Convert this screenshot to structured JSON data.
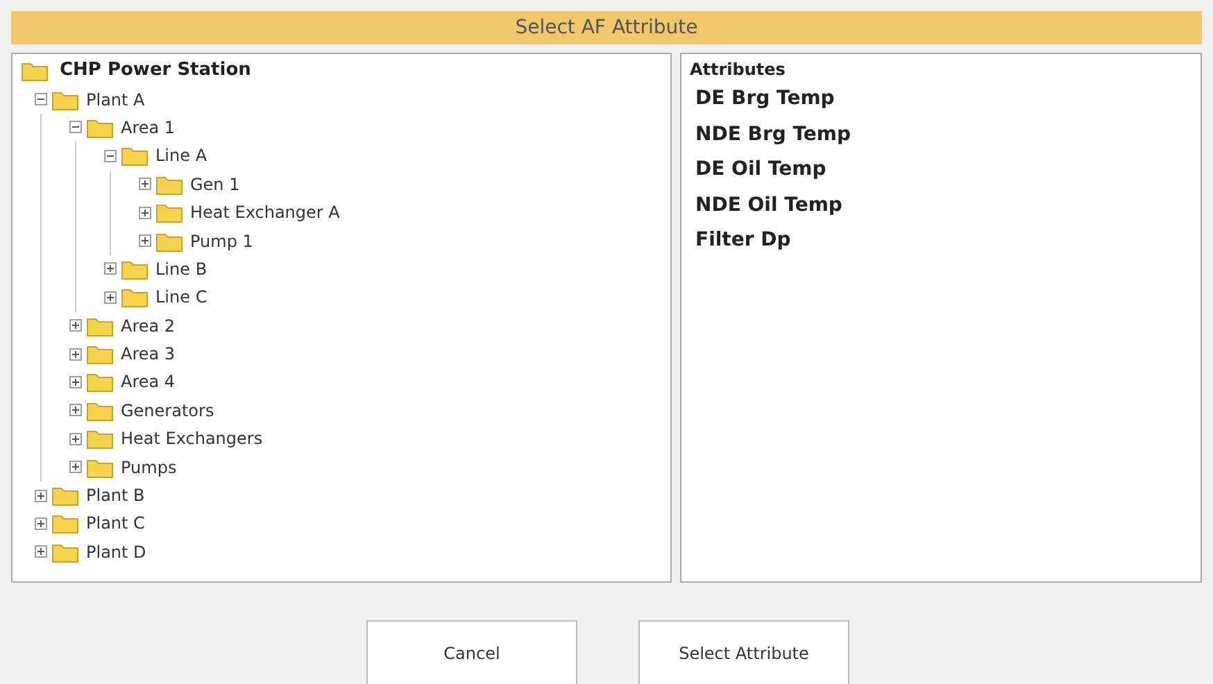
{
  "window": {
    "title": "Select AF Attribute"
  },
  "tree": {
    "label": "CHP Power Station",
    "children": [
      {
        "label": "Plant A",
        "expanded": true,
        "children": [
          {
            "label": "Area 1",
            "expanded": true,
            "children": [
              {
                "label": "Line A",
                "expanded": true,
                "children": [
                  {
                    "label": "Gen 1",
                    "expanded": false
                  },
                  {
                    "label": "Heat Exchanger A",
                    "expanded": false
                  },
                  {
                    "label": "Pump 1",
                    "expanded": false
                  }
                ]
              },
              {
                "label": "Line B",
                "expanded": false
              },
              {
                "label": "Line C",
                "expanded": false
              }
            ]
          },
          {
            "label": "Area 2",
            "expanded": false
          },
          {
            "label": "Area 3",
            "expanded": false
          },
          {
            "label": "Area 4",
            "expanded": false
          },
          {
            "label": "Generators",
            "expanded": false
          },
          {
            "label": "Heat Exchangers",
            "expanded": false
          },
          {
            "label": "Pumps",
            "expanded": false
          }
        ]
      },
      {
        "label": "Plant B",
        "expanded": false
      },
      {
        "label": "Plant C",
        "expanded": false
      },
      {
        "label": "Plant D",
        "expanded": false
      }
    ]
  },
  "attributes": {
    "heading": "Attributes",
    "items": [
      "DE Brg Temp",
      "NDE Brg Temp",
      "DE Oil Temp",
      "NDE Oil Temp",
      "Filter Dp"
    ]
  },
  "buttons": [
    "Cancel",
    "Select Attribute"
  ]
}
